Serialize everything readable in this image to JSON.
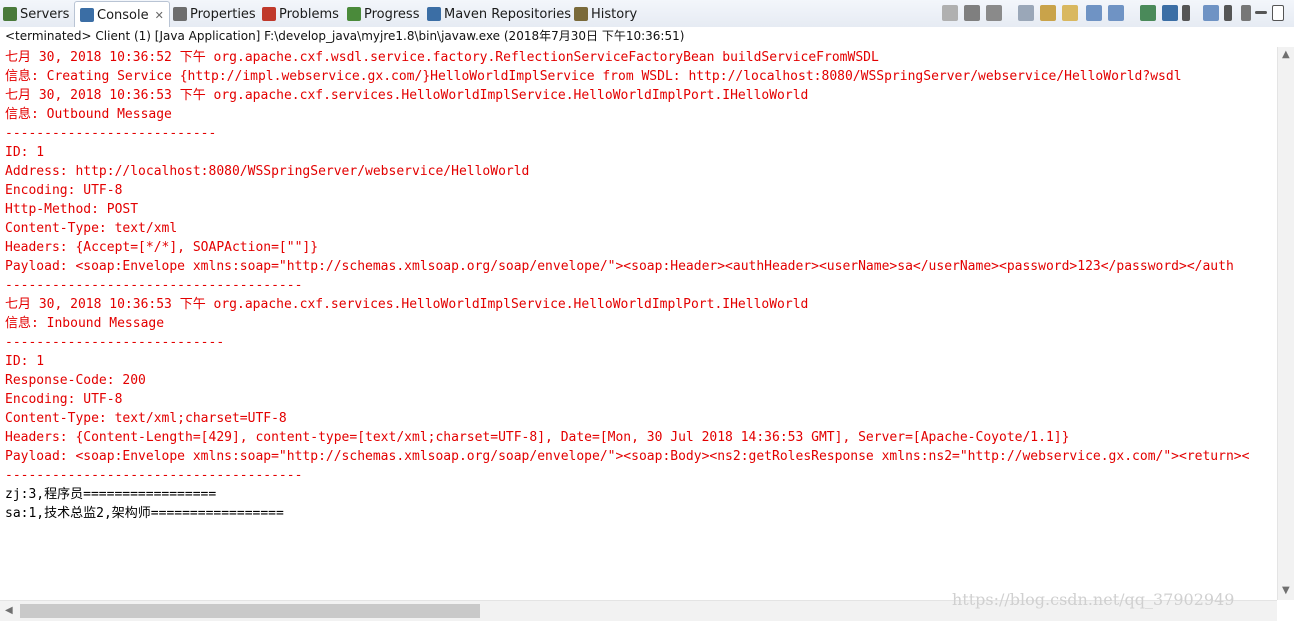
{
  "tabs": [
    {
      "label": "Servers",
      "icon": "servers-icon",
      "color": "#4a7a3a"
    },
    {
      "label": "Console",
      "icon": "console-icon",
      "color": "#3b6ea5",
      "active": true,
      "close": "✕"
    },
    {
      "label": "Properties",
      "icon": "properties-icon",
      "color": "#6d6d6d"
    },
    {
      "label": "Problems",
      "icon": "problems-icon",
      "color": "#c0392b"
    },
    {
      "label": "Progress",
      "icon": "progress-icon",
      "color": "#4a8a3a"
    },
    {
      "label": "Maven Repositories",
      "icon": "maven-icon",
      "color": "#3b6ea5"
    },
    {
      "label": "History",
      "icon": "history-icon",
      "color": "#7a6a3a"
    }
  ],
  "status_line": "<terminated> Client (1) [Java Application] F:\\develop_java\\myjre1.8\\bin\\javaw.exe (2018年7月30日 下午10:36:51)",
  "colors": {
    "stderr": "#e30000",
    "stdout": "#000000"
  },
  "console_lines": [
    {
      "text": "七月 30, 2018 10:36:52 下午 org.apache.cxf.wsdl.service.factory.ReflectionServiceFactoryBean buildServiceFromWSDL",
      "stream": "err"
    },
    {
      "text": "信息: Creating Service {http://impl.webservice.gx.com/}HelloWorldImplService from WSDL: http://localhost:8080/WSSpringServer/webservice/HelloWorld?wsdl",
      "stream": "err"
    },
    {
      "text": "七月 30, 2018 10:36:53 下午 org.apache.cxf.services.HelloWorldImplService.HelloWorldImplPort.IHelloWorld",
      "stream": "err"
    },
    {
      "text": "信息: Outbound Message",
      "stream": "err"
    },
    {
      "text": "---------------------------",
      "stream": "err"
    },
    {
      "text": "ID: 1",
      "stream": "err"
    },
    {
      "text": "Address: http://localhost:8080/WSSpringServer/webservice/HelloWorld",
      "stream": "err"
    },
    {
      "text": "Encoding: UTF-8",
      "stream": "err"
    },
    {
      "text": "Http-Method: POST",
      "stream": "err"
    },
    {
      "text": "Content-Type: text/xml",
      "stream": "err"
    },
    {
      "text": "Headers: {Accept=[*/*], SOAPAction=[\"\"]}",
      "stream": "err"
    },
    {
      "text": "Payload: <soap:Envelope xmlns:soap=\"http://schemas.xmlsoap.org/soap/envelope/\"><soap:Header><authHeader><userName>sa</userName><password>123</password></auth",
      "stream": "err"
    },
    {
      "text": "--------------------------------------",
      "stream": "err"
    },
    {
      "text": "七月 30, 2018 10:36:53 下午 org.apache.cxf.services.HelloWorldImplService.HelloWorldImplPort.IHelloWorld",
      "stream": "err"
    },
    {
      "text": "信息: Inbound Message",
      "stream": "err"
    },
    {
      "text": "----------------------------",
      "stream": "err"
    },
    {
      "text": "ID: 1",
      "stream": "err"
    },
    {
      "text": "Response-Code: 200",
      "stream": "err"
    },
    {
      "text": "Encoding: UTF-8",
      "stream": "err"
    },
    {
      "text": "Content-Type: text/xml;charset=UTF-8",
      "stream": "err"
    },
    {
      "text": "Headers: {Content-Length=[429], content-type=[text/xml;charset=UTF-8], Date=[Mon, 30 Jul 2018 14:36:53 GMT], Server=[Apache-Coyote/1.1]}",
      "stream": "err"
    },
    {
      "text": "Payload: <soap:Envelope xmlns:soap=\"http://schemas.xmlsoap.org/soap/envelope/\"><soap:Body><ns2:getRolesResponse xmlns:ns2=\"http://webservice.gx.com/\"><return><",
      "stream": "err"
    },
    {
      "text": "--------------------------------------",
      "stream": "err"
    },
    {
      "text": "zj:3,程序员=================",
      "stream": "out"
    },
    {
      "text": "sa:1,技术总监2,架构师=================",
      "stream": "out"
    }
  ],
  "watermark": "https://blog.csdn.net/qq_37902949",
  "toolbar_icons": [
    "terminate-icon",
    "remove-launch-icon",
    "remove-all-icon",
    "clear-console-icon",
    "scroll-lock-icon",
    "word-wrap-icon",
    "show-on-stdout-icon",
    "show-on-stderr-icon",
    "pin-console-icon",
    "display-console-icon",
    "display-console-dropdown-icon",
    "open-console-icon",
    "open-console-dropdown-icon",
    "view-menu-icon",
    "minimize-icon",
    "maximize-icon"
  ]
}
